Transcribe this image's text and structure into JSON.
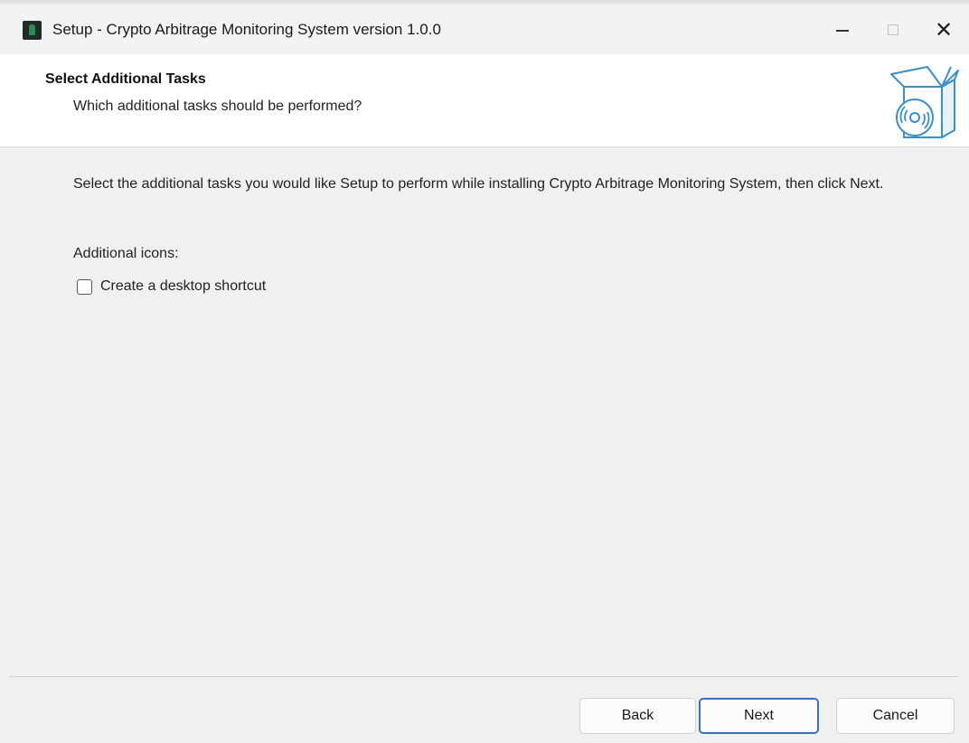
{
  "window": {
    "title": "Setup - Crypto Arbitrage Monitoring System version 1.0.0",
    "app_icon": "app-icon",
    "controls": {
      "minimize_icon": "minimize-icon",
      "maximize_icon": "maximize-icon",
      "close_glyph": "✕"
    }
  },
  "header": {
    "title": "Select Additional Tasks",
    "subtitle": "Which additional tasks should be performed?",
    "icon": "setup-box-icon"
  },
  "body": {
    "description": "Select the additional tasks you would like Setup to perform while installing Crypto Arbitrage Monitoring System, then click Next.",
    "section_label": "Additional icons:",
    "tasks": [
      {
        "label": "Create a desktop shortcut",
        "checked": false
      }
    ]
  },
  "footer": {
    "back_label": "Back",
    "next_label": "Next",
    "cancel_label": "Cancel"
  },
  "colors": {
    "header_bg": "#ffffff",
    "body_bg": "#f0f0f0",
    "default_button_border": "#3b6fb6",
    "icon_outline": "#3b8fc4"
  }
}
